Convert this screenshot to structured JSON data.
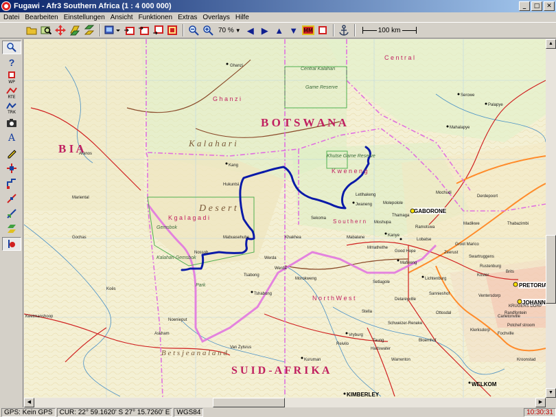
{
  "window": {
    "title": "Fugawi - Afr3  Southern Africa  (1 : 4 000 000)",
    "controls": {
      "minimize": "_",
      "maximize": "□",
      "close": "✕"
    }
  },
  "menubar": {
    "items": [
      "Datei",
      "Bearbeiten",
      "Einstellungen",
      "Ansicht",
      "Funktionen",
      "Extras",
      "Overlays",
      "Hilfe"
    ]
  },
  "toolbar": {
    "zoom_level": "70 %",
    "scale_label": "100 km"
  },
  "map": {
    "labels": {
      "botswana": "B O T S W A N A",
      "kalahari": "K a l a h a r i",
      "desert": "D e s e r t",
      "kgalagadi": "K g a l a g a d i",
      "central": "C e n t r a l",
      "central_kalahari": "Central Kalahari",
      "game_reserve": "Game Reserve",
      "ghanzi": "G h a n z i",
      "kweneng": "K w e n e n g",
      "southern": "S o u t h e r n",
      "north_west": "N o r t h   W e s t",
      "suid_afrika": "S U I D - A F R I K A",
      "bia": "B I A",
      "gaborone": "GABORONE",
      "pretoria": "PRETORIA",
      "johannesburg": "JOHANN",
      "botshabelo": "B e t s j e a n a l a n d",
      "kgalagadi_park": "Gemsbok",
      "park": "Park",
      "kalahari_gemsbok": "Kalahari Gemsbok",
      "welkom": "WELKOM",
      "kimberley": "KIMBERLEY",
      "mafikeng": "Mafikeng",
      "lichtenburg": "Lichtenburg",
      "vryburg": "Vryburg",
      "molepolole": "Molepolole",
      "lobatse": "Lobatse",
      "zeerust": "Zeerust",
      "serowe": "Serowe",
      "palapye": "Palapye",
      "mahalapye": "Mahalapye",
      "kanye": "Kanye",
      "jwaneng": "Jwaneng",
      "tshabong": "Tshabong",
      "werda": "Werda",
      "kuruman": "Kuruman",
      "keetmanshoop": "Keetmanshoop",
      "mariental": "Mariental",
      "rustenburg": "Rustenburg",
      "krugersdorp": "KRUGERS DORP",
      "klerksdorp": "Klerksdorp",
      "potchefstroom": "Potchef stroom",
      "kroonstad": "Kroonstad",
      "ghanzi_town": "Ghanzi",
      "kang": "Kang",
      "letlhakeng": "Letlhakeng",
      "hukuntsi": "Hukuntsi",
      "gwamoswe": "Khutse Game Reserve",
      "sekoma": "Sekoma",
      "mabuasehube": "Mabuasehube",
      "springbok_pan": "Nossob",
      "aranos": "Aranos",
      "gochas": "Gochas",
      "koes": "Koës",
      "noenieput": "Noenieput",
      "askham": "Askham",
      "morokweng": "Morokweng",
      "vanzylsrus": "Van Zylsrus",
      "ottosdal": "Ottosdal",
      "schweizer": "Schweizer-Reneke",
      "bloemhof": "Bloemhof",
      "warrenton": "Warrenton",
      "hartswater": "Hartswater",
      "taung": "Taung",
      "reivilo": "Reivilo",
      "stella": "Stella",
      "setlagole": "Setlagole",
      "delareyville": "Delareyville",
      "sannieshof": "Sannieshof",
      "groot_marico": "Groot Marico",
      "swartruggens": "Swartruggens",
      "koster": "Koster",
      "ventersdorp": "Ventersdorp",
      "fochville": "Fochville",
      "carletonville": "Carletonville",
      "randfontein": "Randfontein",
      "brits": "Brits",
      "thabazimbi": "Thabazimbi",
      "madikwe": "Madikwe",
      "derdepoort": "Derdepoort",
      "mochudi": "Mochudi",
      "ramotswa": "Ramotswa",
      "good_hope": "Good Hope",
      "mmathethe": "Mmathethe",
      "moshupa": "Moshupa",
      "thamaga": "Thamaga",
      "mabalane": "Mabalane",
      "khakhea": "Khakhea",
      "werda_2": "Werda",
      "tsabong_2": "Tsabong"
    }
  },
  "status": {
    "gps": "GPS: Kein GPS",
    "cursor": "CUR: 22° 59.1620' S 27° 15.7260' E",
    "datum": "WGS84",
    "time": "10:30:31"
  },
  "colors": {
    "track": "#0a1aa8",
    "border": "#e070e0",
    "road": "#d02020",
    "water": "#2a7fc4",
    "highway": "#ff8b2a"
  }
}
